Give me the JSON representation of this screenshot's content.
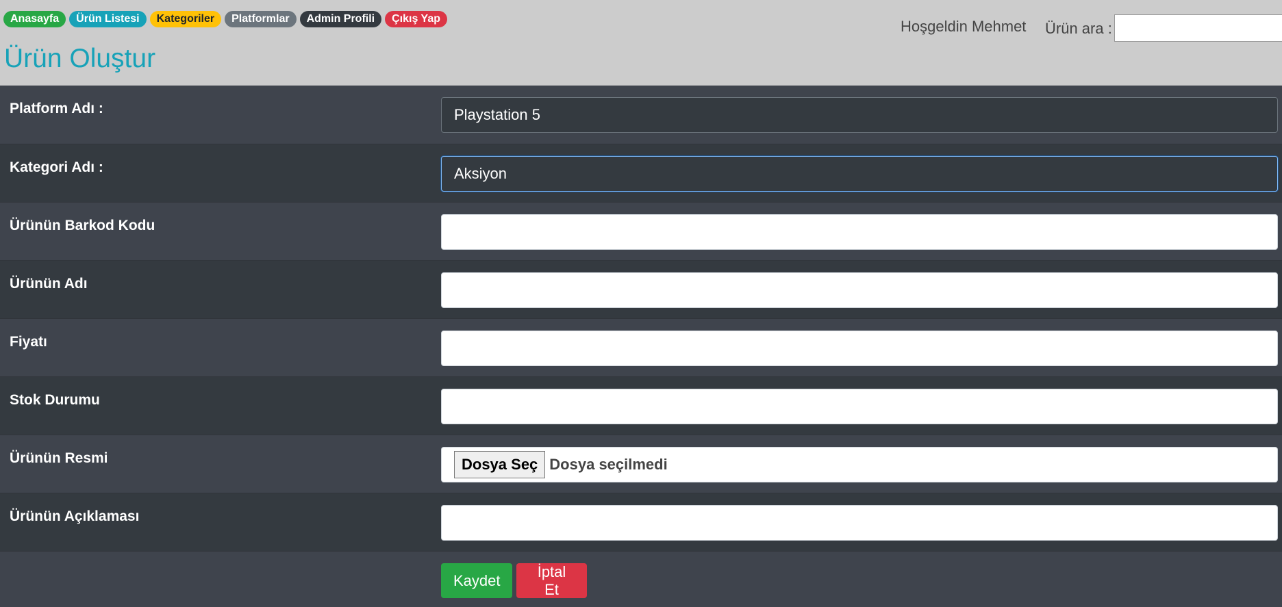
{
  "nav": {
    "items": [
      {
        "label": "Anasayfa",
        "bg": "#28a745",
        "fg": "#ffffff"
      },
      {
        "label": "Ürün Listesi",
        "bg": "#17a2b8",
        "fg": "#ffffff"
      },
      {
        "label": "Kategoriler",
        "bg": "#ffc107",
        "fg": "#212529"
      },
      {
        "label": "Platformlar",
        "bg": "#6c757d",
        "fg": "#ffffff"
      },
      {
        "label": "Admin Profili",
        "bg": "#343a40",
        "fg": "#ffffff"
      },
      {
        "label": "Çıkış Yap",
        "bg": "#dc3545",
        "fg": "#ffffff"
      }
    ]
  },
  "header": {
    "title": "Ürün Oluştur",
    "welcome": "Hoşgeldin Mehmet",
    "search_label": "Ürün ara :",
    "search_value": ""
  },
  "form": {
    "platform": {
      "label": "Platform Adı :",
      "value": "Playstation 5"
    },
    "category": {
      "label": "Kategori Adı :",
      "value": "Aksiyon"
    },
    "barcode": {
      "label": "Ürünün Barkod Kodu",
      "value": ""
    },
    "name": {
      "label": "Ürünün Adı",
      "value": ""
    },
    "price": {
      "label": "Fiyatı",
      "value": ""
    },
    "stock": {
      "label": "Stok Durumu",
      "value": ""
    },
    "image": {
      "label": "Ürünün Resmi",
      "button": "Dosya Seç",
      "status": "Dosya seçilmedi"
    },
    "description": {
      "label": "Ürünün Açıklaması",
      "value": ""
    }
  },
  "actions": {
    "save": "Kaydet",
    "cancel": "İptal Et"
  },
  "colors": {
    "title": "#17a2b8",
    "header_bg": "#cccccc",
    "row_odd": "#3f444d",
    "row_even": "#343a40",
    "save": "#28a745",
    "cancel": "#dc3545"
  }
}
